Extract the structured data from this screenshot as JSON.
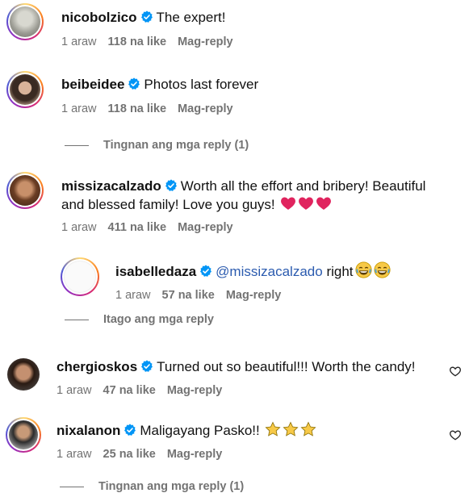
{
  "comments": [
    {
      "username": "nicobolzico",
      "text": "The expert!",
      "time": "1 araw",
      "likes": "118 na like",
      "reply": "Mag-reply"
    },
    {
      "username": "beibeidee",
      "text": "Photos last forever",
      "time": "1 araw",
      "likes": "118 na like",
      "reply": "Mag-reply",
      "view_replies": "Tingnan ang mga reply (1)"
    },
    {
      "username": "missizacalzado",
      "text_line1": "Worth all the effort and bribery! Beautiful",
      "text_line2": "and blessed family! Love you guys!",
      "time": "1 araw",
      "likes": "411 na like",
      "reply": "Mag-reply"
    },
    {
      "username": "isabelledaza",
      "mention": "@missizacalzado",
      "text": "right",
      "time": "1 araw",
      "likes": "57 na like",
      "reply": "Mag-reply",
      "hide_replies": "Itago ang mga reply"
    },
    {
      "username": "chergioskos",
      "text": "Turned out so beautiful!!! Worth the candy!",
      "time": "1 araw",
      "likes": "47 na like",
      "reply": "Mag-reply"
    },
    {
      "username": "nixalanon",
      "text": "Maligayang Pasko!!",
      "time": "1 araw",
      "likes": "25 na like",
      "reply": "Mag-reply",
      "view_replies": "Tingnan ang mga reply (1)"
    }
  ],
  "colors": {
    "verified": "#0095f6",
    "heart": "#e0245e",
    "star": "#f7c948",
    "meta": "#737373"
  }
}
